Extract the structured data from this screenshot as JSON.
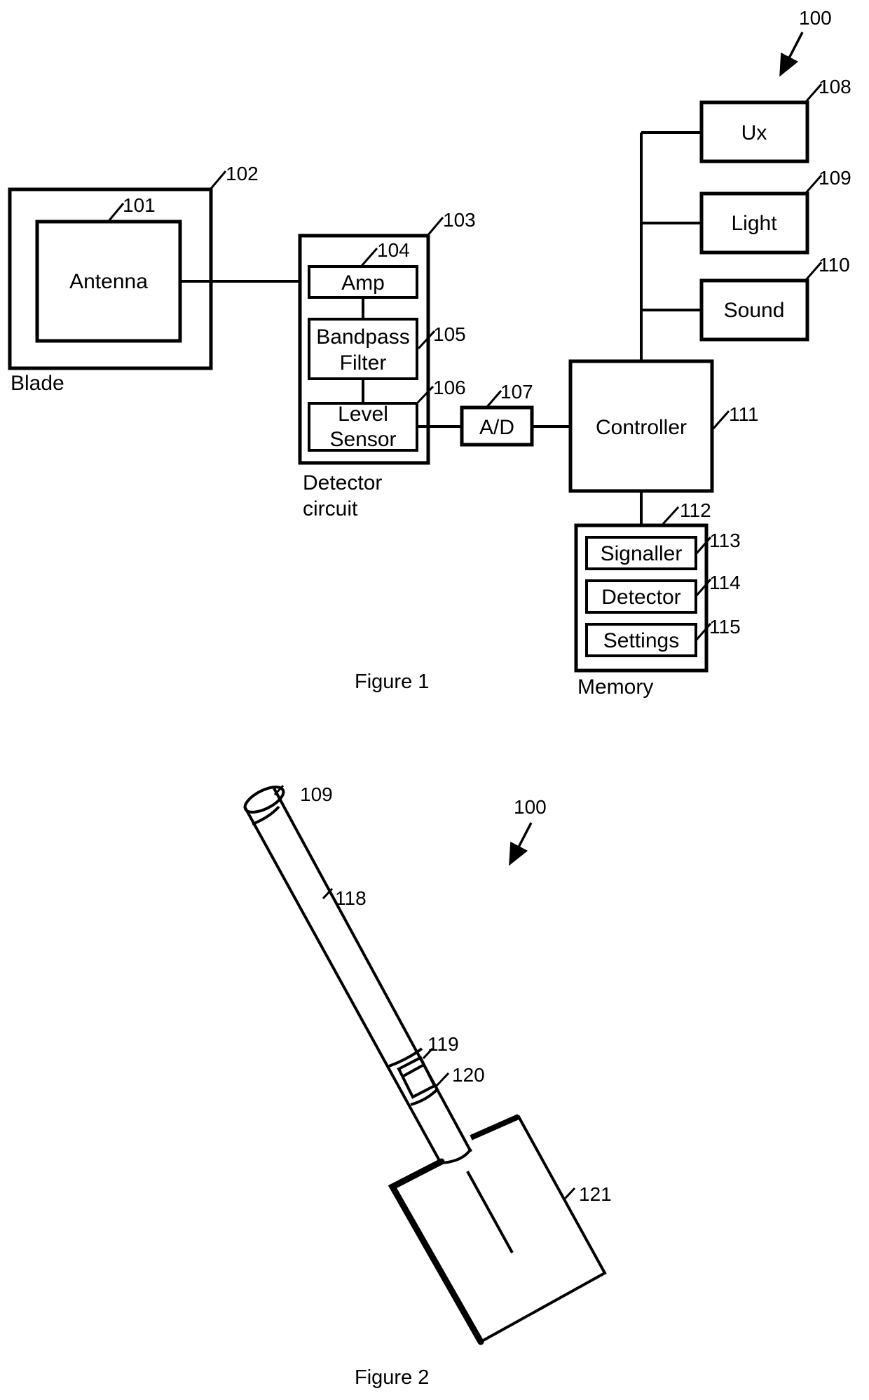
{
  "figure1": {
    "caption": "Figure 1",
    "system_ref": "100",
    "blade": {
      "ref": "102",
      "label": "Blade"
    },
    "antenna": {
      "ref": "101",
      "label": "Antenna"
    },
    "detector_circuit": {
      "ref": "103",
      "label_line1": "Detector",
      "label_line2": "circuit"
    },
    "amp": {
      "ref": "104",
      "label": "Amp"
    },
    "bandpass_filter": {
      "ref": "105",
      "label_line1": "Bandpass",
      "label_line2": "Filter"
    },
    "level_sensor": {
      "ref": "106",
      "label_line1": "Level",
      "label_line2": "Sensor"
    },
    "adc": {
      "ref": "107",
      "label": "A/D"
    },
    "ux": {
      "ref": "108",
      "label": "Ux"
    },
    "light": {
      "ref": "109",
      "label": "Light"
    },
    "sound": {
      "ref": "110",
      "label": "Sound"
    },
    "controller": {
      "ref": "111",
      "label": "Controller"
    },
    "memory": {
      "ref": "112",
      "label": "Memory",
      "modules": [
        {
          "ref": "113",
          "label": "Signaller"
        },
        {
          "ref": "114",
          "label": "Detector"
        },
        {
          "ref": "115",
          "label": "Settings"
        }
      ]
    }
  },
  "figure2": {
    "caption": "Figure 2",
    "system_ref": "100",
    "refs": {
      "light": "109",
      "shaft": "118",
      "collar": "119",
      "button": "120",
      "blade": "121"
    }
  }
}
